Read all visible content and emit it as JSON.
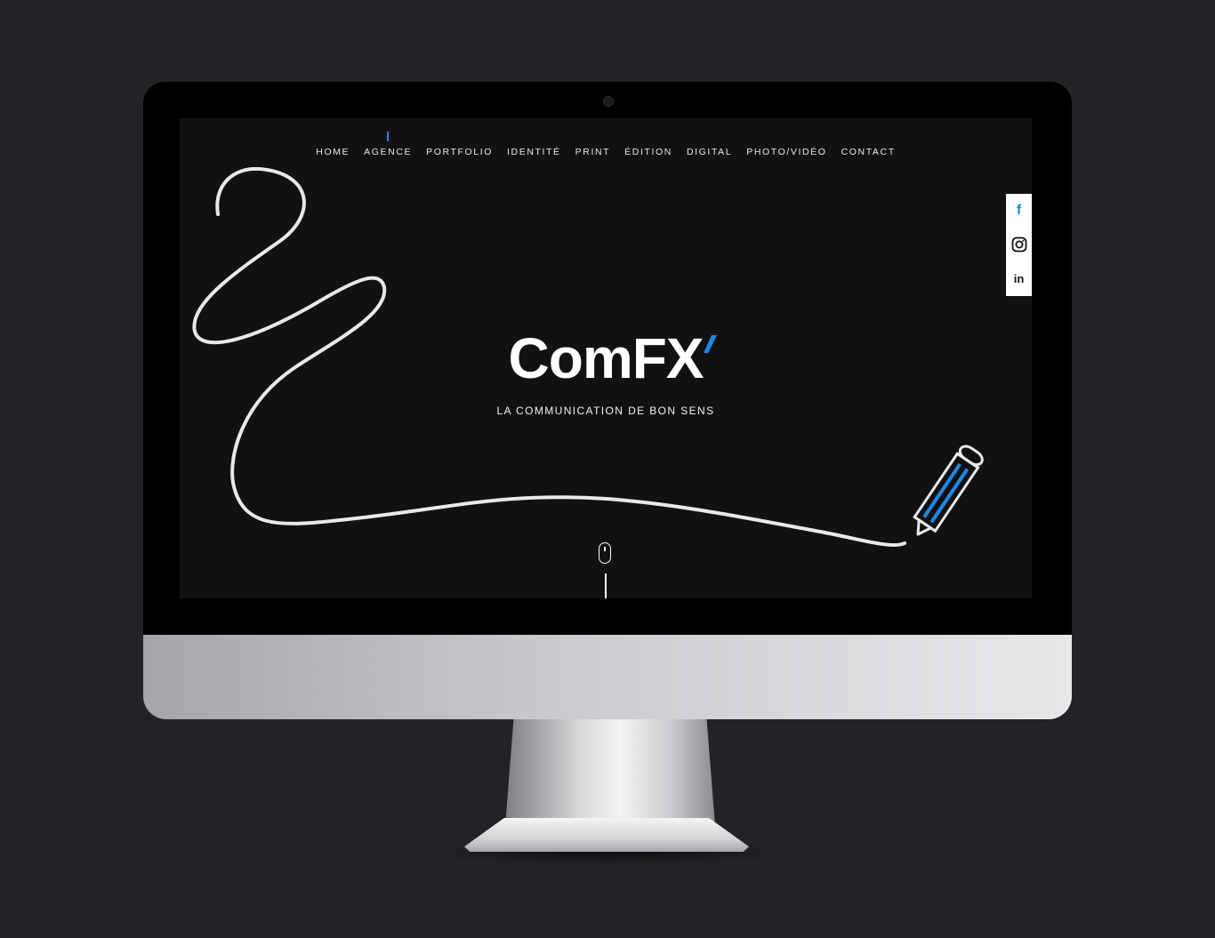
{
  "nav": {
    "items": [
      "HOME",
      "AGENCE",
      "PORTFOLIO",
      "IDENTITÉ",
      "PRINT",
      "ÉDITION",
      "DIGITAL",
      "PHOTO/VIDÉO",
      "CONTACT"
    ],
    "active": "AGENCE"
  },
  "hero": {
    "logo": "ComFX",
    "tagline": "LA COMMUNICATION DE BON SENS"
  },
  "social": {
    "facebook": "f",
    "instagram": "instagram-icon",
    "linkedin": "in"
  },
  "colors": {
    "accent": "#1e88e5",
    "background": "#111112",
    "page": "#232327"
  }
}
